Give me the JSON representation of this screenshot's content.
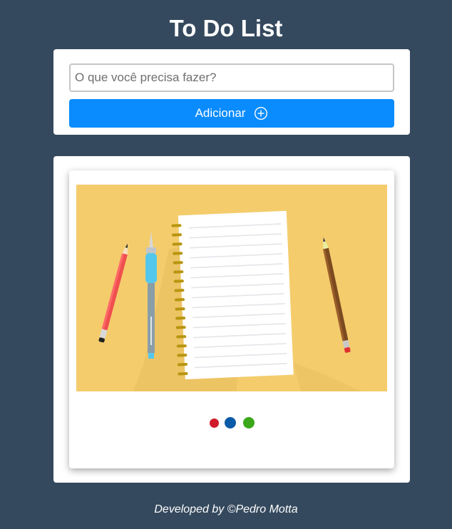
{
  "header": {
    "title": "To Do List"
  },
  "form": {
    "placeholder": "O que você precisa fazer?",
    "button_label": "Adicionar",
    "button_icon": "plus-circle-icon"
  },
  "task_list": {
    "items": [],
    "empty_illustration": "notebook-and-pencils-illustration",
    "status_dots": [
      {
        "name": "red-dot",
        "color": "#d01c2a"
      },
      {
        "name": "blue-dot",
        "color": "#0a5aa8"
      },
      {
        "name": "green-dot",
        "color": "#3ba71a"
      }
    ]
  },
  "footer": {
    "text": "Developed by ©Pedro Motta"
  },
  "colors": {
    "background": "#35495e",
    "accent": "#0a8cff",
    "illustration_bg": "#f4cc6c"
  }
}
